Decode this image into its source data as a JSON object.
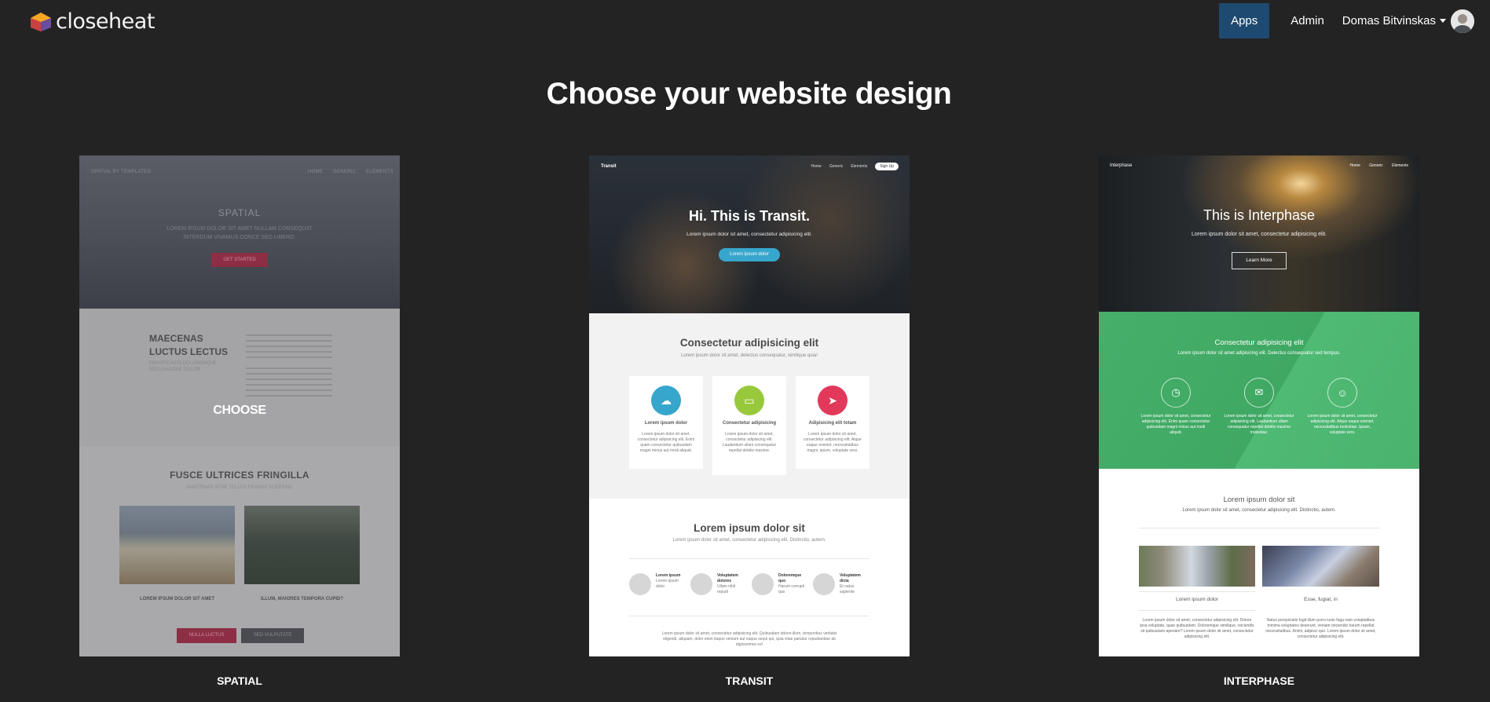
{
  "navbar": {
    "brand": "closeheat",
    "links": [
      "Apps",
      "Admin"
    ],
    "active": "Apps",
    "user_name": "Domas Bitvinskas"
  },
  "page": {
    "title": "Choose your website design"
  },
  "designs": [
    {
      "label": "SPATIAL",
      "hover_label": "CHOOSE",
      "preview": {
        "topbar_brand": "SPATIAL BY TEMPLATED",
        "nav": [
          "HOME",
          "GENERIC",
          "ELEMENTS"
        ],
        "hero_title": "SPATIAL",
        "hero_sub_1": "LOREM IPSUM DOLOR SIT AMET NULLAM CONSEQUAT",
        "hero_sub_2": "INTERDUM VIVAMUS DONCE SED LIBERO.",
        "hero_button": "GET STARTED",
        "mid_heading_1": "MAECENAS",
        "mid_heading_2": "LUCTUS LECTUS",
        "mid_sub_1": "PERSPICIATIS DOLOREMQUE",
        "mid_sub_2": "RECUSANDAE DOLOR",
        "bottom_title": "FUSCE ULTRICES FRINGILLA",
        "bottom_sub": "MAECENAS VITAE TELLUS FEUGIAT ELEIFEND",
        "caption_1": "LOREM IPSUM DOLOR SIT AMET",
        "caption_2": "ILLUM, MAIORES TEMPORA CUPID?",
        "button_1": "NULLA LUCTUS",
        "button_2": "SED VULPUTATE"
      }
    },
    {
      "label": "TRANSIT",
      "preview": {
        "logo": "Transit",
        "nav": [
          "Home",
          "Generic",
          "Elements"
        ],
        "signup": "Sign Up",
        "hero_title": "Hi. This is Transit.",
        "hero_sub": "Lorem ipsum dolor sit amet, consectetur adipisicing elit.",
        "hero_button": "Lorem ipsum dolor",
        "mid_title": "Consectetur adipisicing elit",
        "mid_sub": "Lorem ipsum dolor sit amet, delectus consequatur, similique quia!",
        "features": [
          {
            "title": "Lorem ipsum dolor",
            "text": "Lorem ipsum dolor sit amet, consectetur adipisicing elit. Enim quam consectetur quibusdam magni minus aut modi aliquid.",
            "color": "#37a6cd",
            "icon": "cloud-icon",
            "glyph": "☁"
          },
          {
            "title": "Consectetur adipisicing",
            "text": "Lorem ipsum dolor sit amet, consectetur adipisicing elit. Laudantium ullam consequatur repellat debitis maxime.",
            "color": "#98c93c",
            "icon": "desktop-icon",
            "glyph": "▭"
          },
          {
            "title": "Adipisicing elit totam",
            "text": "Lorem ipsum dolor sit amet, consectetur adipisicing elit. Atque eaque eveniet, necessitatibus magni, ipsum, voluptate vero.",
            "color": "#e2395b",
            "icon": "rocket-icon",
            "glyph": "➤"
          }
        ],
        "bottom_title": "Lorem ipsum dolor sit",
        "bottom_sub": "Lorem ipsum dolor sit amet, consectetur adipisicing elit. Distinctio, autem.",
        "people": [
          {
            "name": "Lorem ipsum",
            "role": "Lorem ipsum dolor"
          },
          {
            "name": "Voluptatem dolores",
            "role": "Ullam nihil repudi"
          },
          {
            "name": "Doloremque quo",
            "role": "Harum corrupti quo"
          },
          {
            "name": "Voluptatem dicta",
            "role": "Et natus sapiente"
          }
        ],
        "footer_text": "Lorem ipsum dolor sit amet, consectetur adipisicing elit. Quibusdam dolore illum, temporibus veritatis eligendi, aliquam, dolor enim itaque veniam aut eaque sequi qui, quia vitae pariatur repudiandae ab dignissimos ex!"
      }
    },
    {
      "label": "INTERPHASE",
      "preview": {
        "logo": "Interphase",
        "nav": [
          "Home",
          "Generic",
          "Elements"
        ],
        "hero_title": "This is Interphase",
        "hero_sub": "Lorem ipsum dolor sit amet, consectetur adipisicing elit.",
        "hero_button": "Learn More",
        "mid_title": "Consectetur adipisicing elit",
        "mid_sub": "Lorem ipsum dolor sit amet adipisicing elit. Delectus consequatur sed tempus.",
        "features": [
          {
            "text": "Lorem ipsum dolor sit amet, consectetur adipisicing elit. Enim quam consectetur quibusdam magni minus aut modi aliquid.",
            "icon": "clock-icon",
            "glyph": "◷"
          },
          {
            "text": "Lorem ipsum dolor sit amet, consectetur adipisicing elit. Laudantium ullam consequatur repellat debitis maxime molestiae.",
            "icon": "chat-icon",
            "glyph": "✉"
          },
          {
            "text": "Lorem ipsum dolor sit amet, consectetur adipisicing elit. Atque eaque eveniet, necessitatibus molestiae. Ipsum, voluptate vero.",
            "icon": "user-icon",
            "glyph": "☺"
          }
        ],
        "bottom_title": "Lorem ipsum dolor sit",
        "bottom_sub": "Lorem ipsum dolor sit amet, consectetur adipisicing elit. Distinctio, autem.",
        "caption_1": "Lorem ipsum dolor",
        "caption_2": "Esse, fugiat, in",
        "text_1": "Lorem ipsum dolor sit amet, consectetur adipisicing elit. Dolore ipsa voluptate, quae quibusdam. Doloremque similique, reiciendis sit quibusdam aperiam? Lorem ipsum dolor sit amet, consectetur adipisicing elit.",
        "text_2": "Natus perspiciatis fugit illum porro iusto fuga nam voluptatibus minima voluptates deserunt, veniam reiciendis harum repellat necessitatibus. Animi, adipisci quo. Lorem ipsum dolor sit amet, consectetur adipisicing elit."
      }
    }
  ],
  "colors": {
    "background": "#232323",
    "active_nav": "#1e4a71",
    "spatial_accent": "#8e2e45",
    "transit_blue": "#37a6cd",
    "interphase_green": "#46b06b"
  }
}
